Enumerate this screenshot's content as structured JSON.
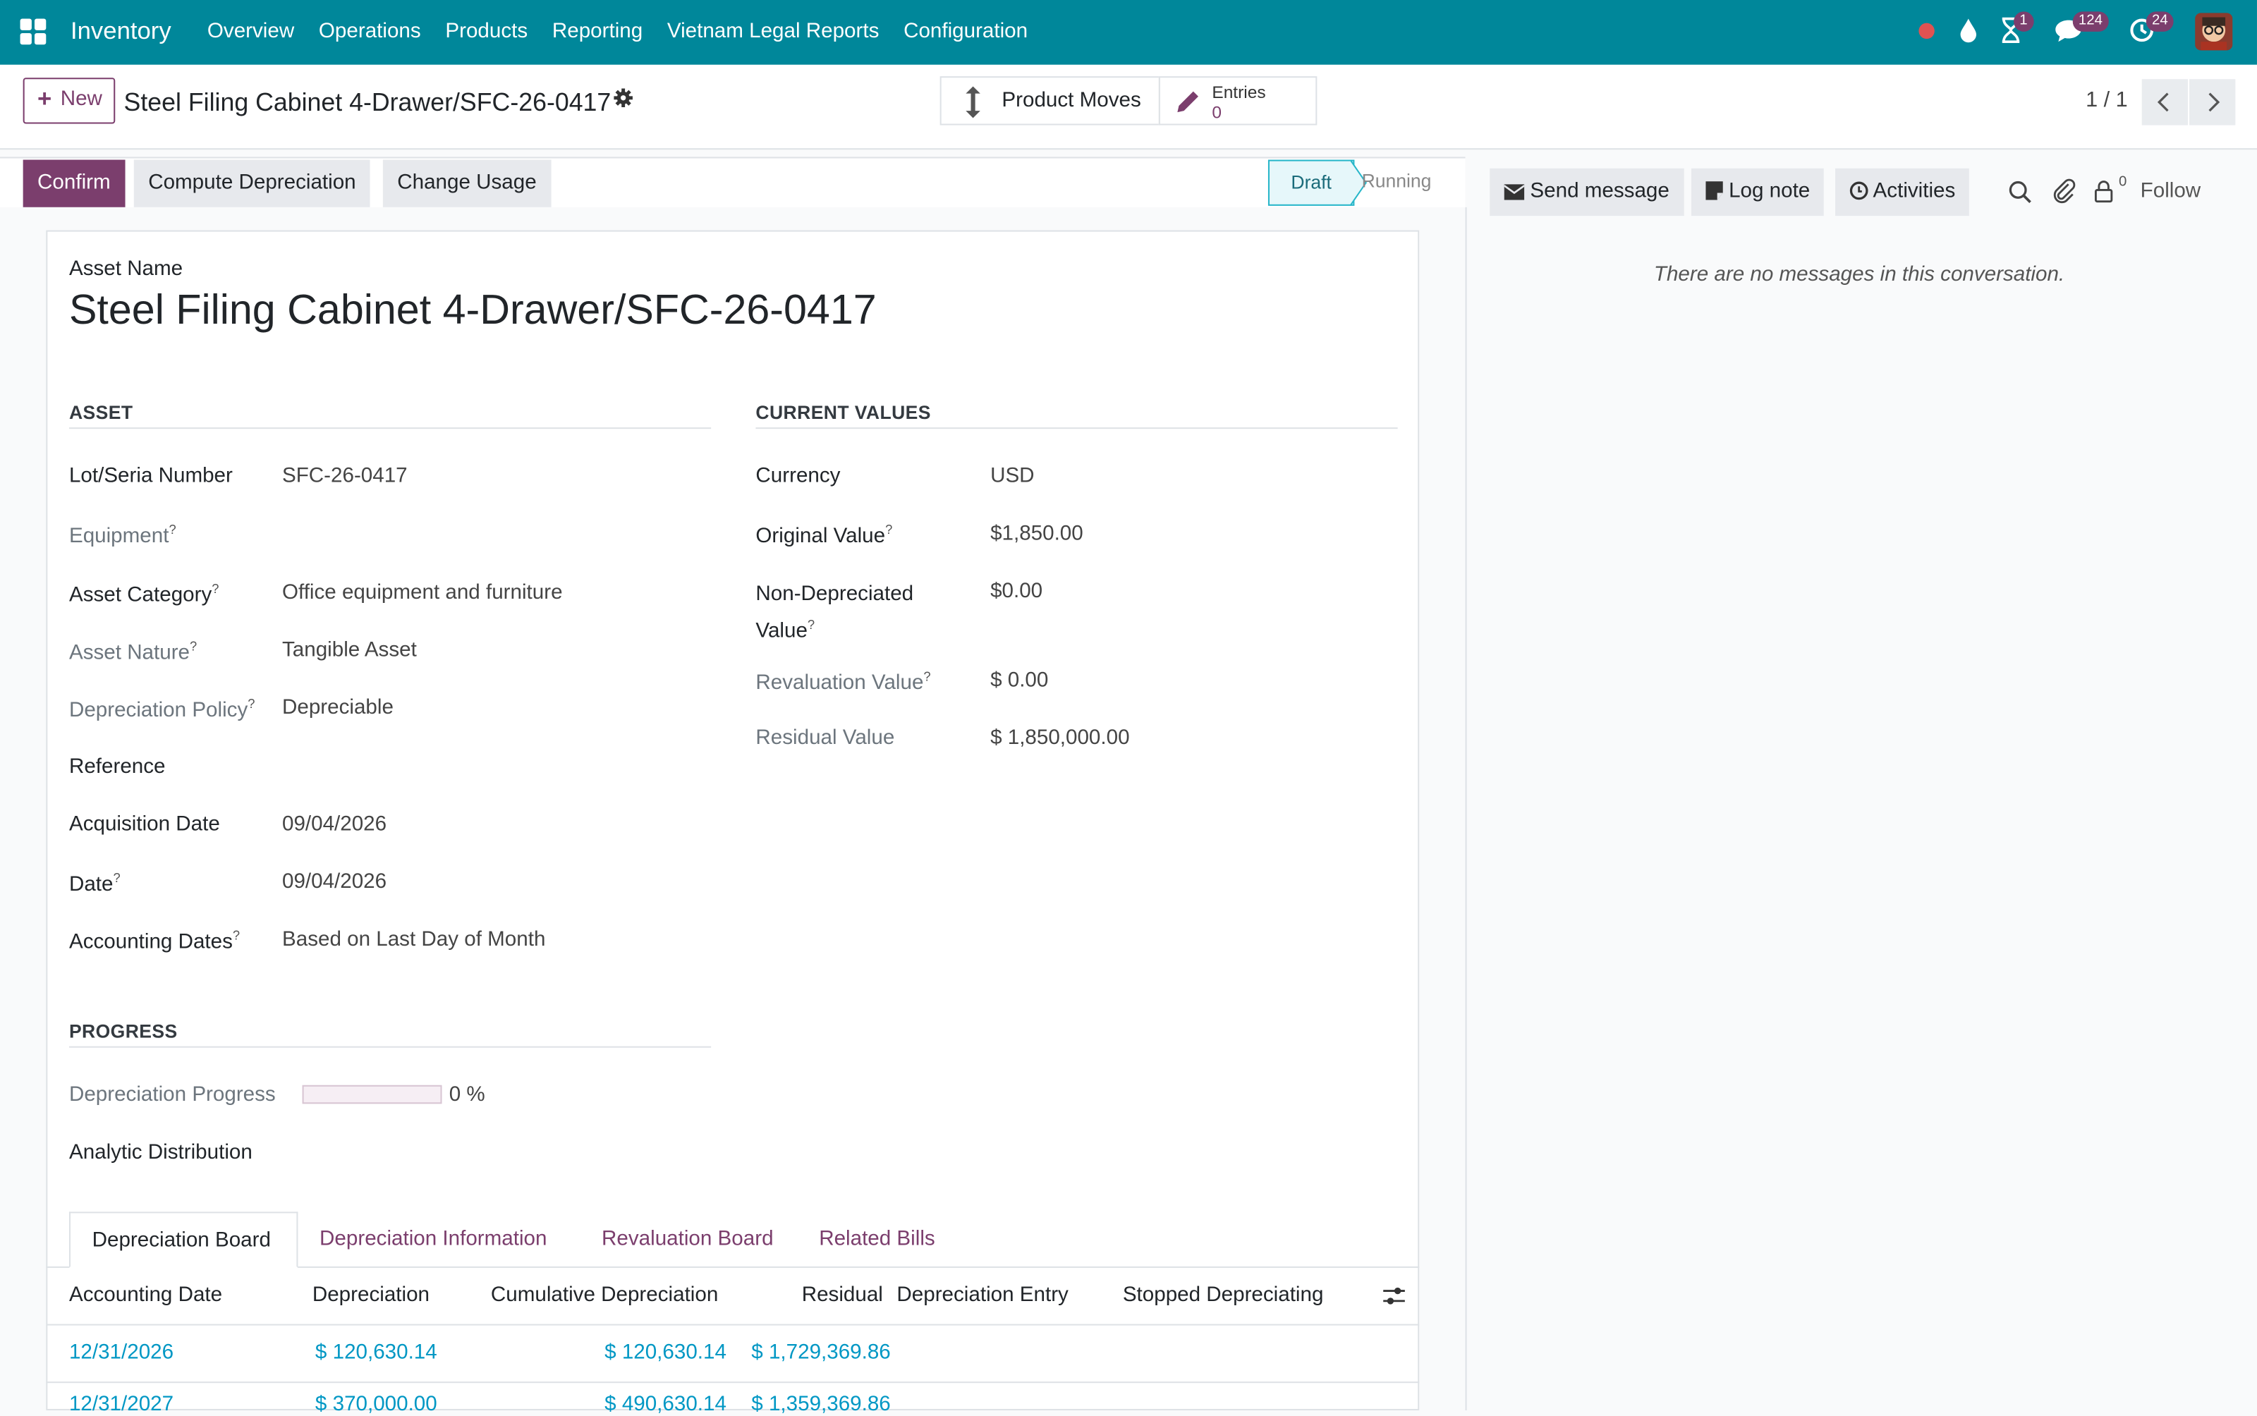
{
  "navbar": {
    "brand": "Inventory",
    "menu": [
      "Overview",
      "Operations",
      "Products",
      "Reporting",
      "Vietnam Legal Reports",
      "Configuration"
    ],
    "badges": {
      "activity": "1",
      "messages": "124",
      "updates": "24"
    }
  },
  "control": {
    "new_label": "New",
    "breadcrumb": "Steel Filing Cabinet 4-Drawer/SFC-26-0417",
    "smart_product_moves": "Product Moves",
    "smart_entries_label": "Entries",
    "smart_entries_value": "0",
    "pager": "1 / 1"
  },
  "statusbar": {
    "confirm": "Confirm",
    "compute": "Compute Depreciation",
    "change_usage": "Change Usage",
    "stage_draft": "Draft",
    "stage_running": "Running"
  },
  "form": {
    "title_label": "Asset Name",
    "title": "Steel Filing Cabinet 4-Drawer/SFC-26-0417",
    "section_asset": "ASSET",
    "section_current": "CURRENT VALUES",
    "section_progress": "PROGRESS",
    "asset_fields": [
      {
        "label": "Lot/Seria Number",
        "value": "SFC-26-0417"
      },
      {
        "label": "Equipment",
        "value": ""
      },
      {
        "label": "Asset Category",
        "value": "Office equipment and furniture"
      },
      {
        "label": "Asset Nature",
        "value": "Tangible Asset"
      },
      {
        "label": "Depreciation Policy",
        "value": "Depreciable"
      },
      {
        "label": "Reference",
        "value": ""
      },
      {
        "label": "Acquisition Date",
        "value": "09/04/2026"
      },
      {
        "label": "Date",
        "value": "09/04/2026"
      },
      {
        "label": "Accounting Dates",
        "value": "Based on Last Day of Month"
      }
    ],
    "current_fields": [
      {
        "label": "Currency",
        "value": "USD"
      },
      {
        "label": "Original Value",
        "value": "$1,850.00"
      },
      {
        "label": "Non-Depreciated Value",
        "value": "$0.00"
      },
      {
        "label": "Revaluation Value",
        "value": "$ 0.00"
      },
      {
        "label": "Residual Value",
        "value": "$ 1,850,000.00"
      }
    ],
    "progress_label": "Depreciation Progress",
    "progress_value": "0 %",
    "progress_fraction": 0,
    "analytic_label": "Analytic Distribution"
  },
  "tabs": [
    "Depreciation Board",
    "Depreciation Information",
    "Revaluation Board",
    "Related Bills"
  ],
  "table": {
    "headers": [
      "Accounting Date",
      "Depreciation",
      "Cumulative Depreciation",
      "Residual",
      "Depreciation Entry",
      "Stopped Depreciating"
    ],
    "rows": [
      {
        "date": "12/31/2026",
        "depreciation": "$ 120,630.14",
        "cumulative": "$ 120,630.14",
        "residual": "$ 1,729,369.86"
      },
      {
        "date": "12/31/2027",
        "depreciation": "$ 370,000.00",
        "cumulative": "$ 490,630.14",
        "residual": "$ 1,359,369.86"
      }
    ]
  },
  "chatter": {
    "send_message": "Send message",
    "log_note": "Log note",
    "activities": "Activities",
    "follower_count": "0",
    "follow": "Follow",
    "empty": "There are no messages in this conversation."
  }
}
